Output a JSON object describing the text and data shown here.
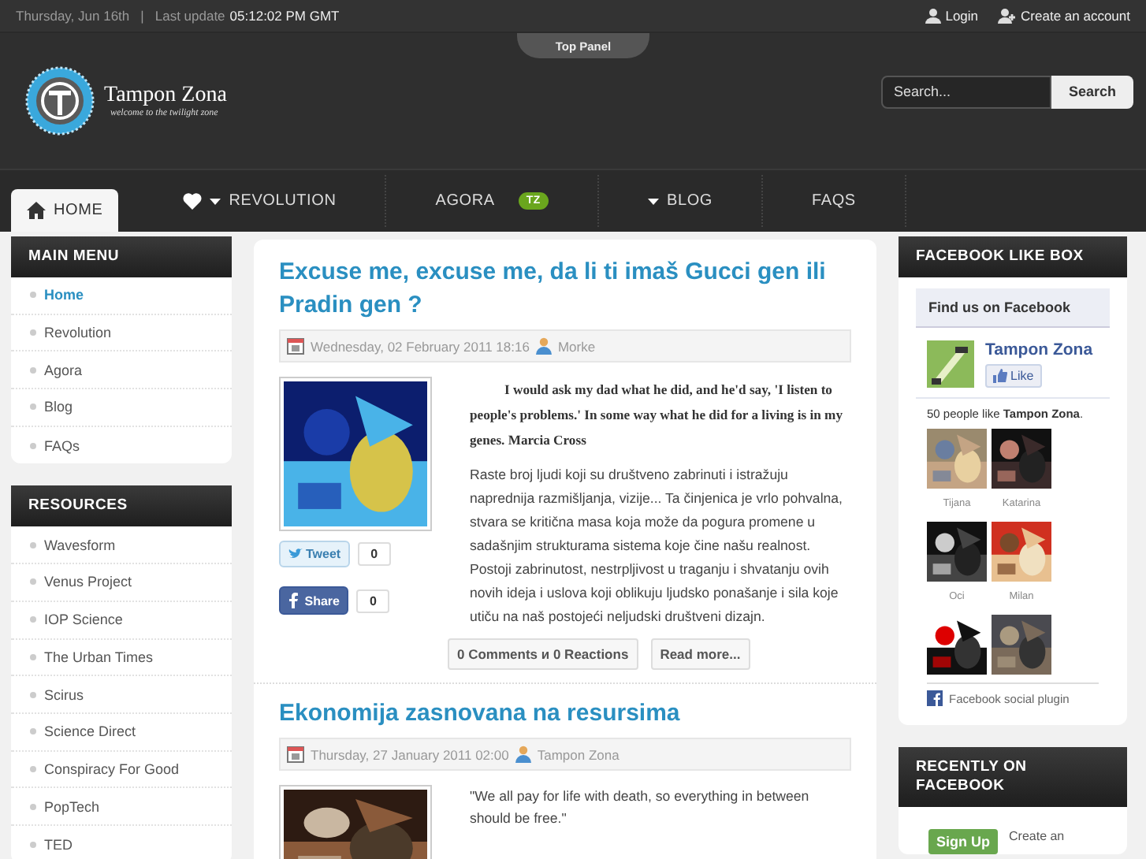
{
  "top_bar": {
    "date": "Thursday, Jun 16th",
    "separator": "|",
    "update_label": "Last update",
    "update_time": "05:12:02 PM GMT",
    "login": "Login",
    "create_account": "Create an account"
  },
  "top_panel": "Top Panel",
  "logo": {
    "title": "Tampon Zona",
    "tagline": "welcome to the twilight zone"
  },
  "search": {
    "placeholder": "Search...",
    "button": "Search"
  },
  "nav": [
    {
      "label": "HOME",
      "kind": "home",
      "selected": true
    },
    {
      "label": "REVOLUTION",
      "kind": "heart",
      "selected": false
    },
    {
      "label": "AGORA",
      "kind": "badge",
      "badge": "TZ",
      "selected": false
    },
    {
      "label": "BLOG",
      "kind": "caret",
      "selected": false
    },
    {
      "label": "FAQS",
      "kind": "plain",
      "selected": false
    }
  ],
  "main_menu": {
    "title": "MAIN MENU",
    "items": [
      {
        "label": "Home",
        "selected": true
      },
      {
        "label": "Revolution",
        "selected": false
      },
      {
        "label": "Agora",
        "selected": false
      },
      {
        "label": "Blog",
        "selected": false
      },
      {
        "label": "FAQs",
        "selected": false
      }
    ]
  },
  "resources": {
    "title": "RESOURCES",
    "items": [
      "Wavesform",
      "Venus Project",
      "IOP Science",
      "The Urban Times",
      "Scirus",
      "Science Direct",
      "Conspiracy For Good",
      "PopTech",
      "TED"
    ]
  },
  "articles": [
    {
      "title": "Excuse me, excuse me, da li ti imaš Gucci gen ili Pradin gen ?",
      "date": "Wednesday, 02 February 2011 18:16",
      "author": "Morke",
      "quote": "I would ask my dad what he did, and he'd say, 'I listen to people's problems.' In some way what he did for a living is in my genes. Marcia Cross",
      "body": "Raste broj ljudi koji su društveno zabrinuti i istražuju naprednija razmišljanja, vizije... Ta činjenica je vrlo pohvalna, stvara se kritična masa koja može da pogura promene u sadašnjim strukturama sistema koje čine našu realnost. Postoji zabrinutost, nestrpljivost u traganju i shvatanju ovih novih ideja i uslova koji oblikuju ljudsko ponašanje i sila koje utiču na naš postojeći neljudski društveni dizajn.",
      "tweet": "Tweet",
      "tweet_count": "0",
      "share": "Share",
      "share_count": "0",
      "comments": "0 Comments и 0 Reactions",
      "read_more": "Read more..."
    },
    {
      "title": "Ekonomija zasnovana na resursima",
      "date": "Thursday, 27 January 2011 02:00",
      "author": "Tampon Zona",
      "quote": "\"We all pay for life with death, so everything in between should be free.\""
    }
  ],
  "facebook_box": {
    "title": "FACEBOOK LIKE BOX",
    "find_us": "Find us on Facebook",
    "page_name": "Tampon Zona",
    "like": "Like",
    "count_text": "50 people like **Tampon Zona**.",
    "friends": [
      {
        "kind": "named",
        "name": "Tijana"
      },
      {
        "kind": "named",
        "name": "Katarina"
      },
      {
        "kind": "named",
        "name": "Oci"
      },
      {
        "kind": "named",
        "name": "Milan"
      },
      {
        "kind": "unnamed"
      },
      {
        "kind": "unnamed"
      }
    ],
    "plugin": "Facebook social plugin"
  },
  "recent": {
    "title": "RECENTLY ON FACEBOOK",
    "sign_up": "Sign Up",
    "create": "Create an"
  }
}
